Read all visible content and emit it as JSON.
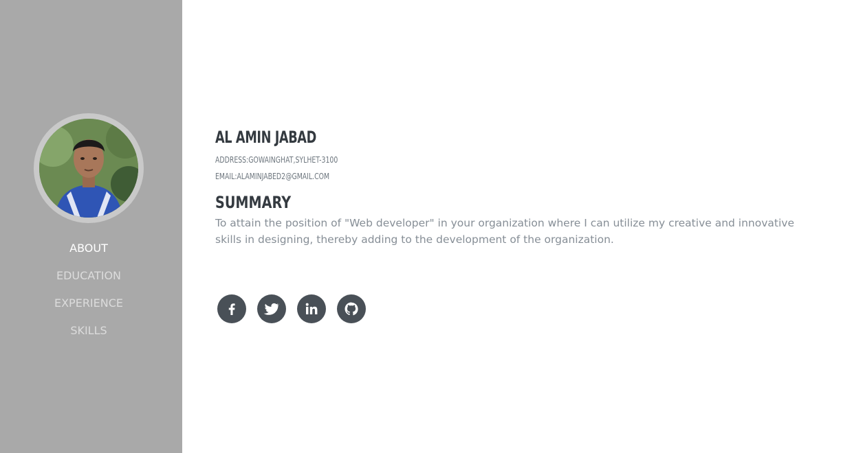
{
  "profile": {
    "name": "AL AMIN JABAD",
    "address": "ADDRESS:GOWAINGHAT,SYLHET-3100",
    "email": "EMAIL:ALAMINJABED2@GMAIL.COM"
  },
  "nav": {
    "items": [
      {
        "label": "ABOUT",
        "active": true
      },
      {
        "label": "EDUCATION",
        "active": false
      },
      {
        "label": "EXPERIENCE",
        "active": false
      },
      {
        "label": "SKILLS",
        "active": false
      }
    ]
  },
  "summary": {
    "title": "SUMMARY",
    "text": "To attain the position of \"Web developer\" in your organization where I can utilize my creative and innovative skills in designing, thereby adding to the development of the organization."
  },
  "social": {
    "icons": [
      "facebook-icon",
      "twitter-icon",
      "linkedin-icon",
      "github-icon"
    ]
  },
  "colors": {
    "sidebar": "#a9a9a9",
    "heading": "#343a40",
    "body_text": "#868e96",
    "icon_bg": "#495057"
  }
}
